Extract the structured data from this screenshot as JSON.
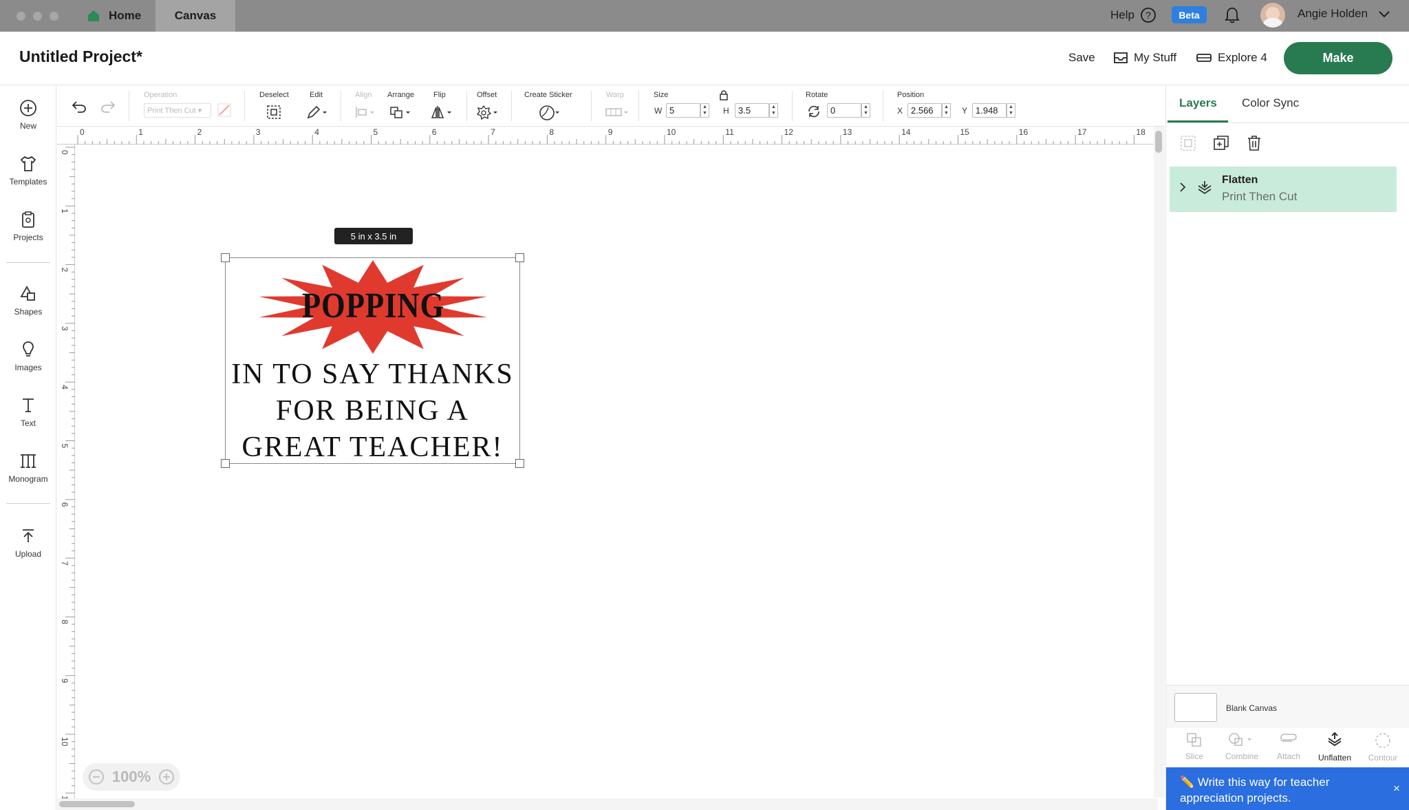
{
  "topbar": {
    "tabs": [
      {
        "label": "Home"
      },
      {
        "label": "Canvas"
      }
    ],
    "help_label": "Help",
    "beta_label": "Beta",
    "user_name": "Angie Holden"
  },
  "header": {
    "project_title": "Untitled Project*",
    "save_label": "Save",
    "mystuff_label": "My Stuff",
    "machine_label": "Explore 4",
    "make_label": "Make"
  },
  "leftbar": {
    "items": [
      {
        "label": "New",
        "icon": "plus-circle-icon"
      },
      {
        "label": "Templates",
        "icon": "tshirt-icon"
      },
      {
        "label": "Projects",
        "icon": "clipboard-icon"
      },
      {
        "label": "Shapes",
        "icon": "shapes-icon"
      },
      {
        "label": "Images",
        "icon": "lightbulb-icon"
      },
      {
        "label": "Text",
        "icon": "text-icon"
      },
      {
        "label": "Monogram",
        "icon": "monogram-icon"
      },
      {
        "label": "Upload",
        "icon": "upload-icon"
      }
    ]
  },
  "toolbar": {
    "operation_label": "Operation",
    "operation_value": "Print Then Cut",
    "deselect_label": "Deselect",
    "edit_label": "Edit",
    "align_label": "Align",
    "arrange_label": "Arrange",
    "flip_label": "Flip",
    "offset_label": "Offset",
    "create_sticker_label": "Create Sticker",
    "warp_label": "Warp",
    "size_label": "Size",
    "w_label": "W",
    "w_value": "5",
    "h_label": "H",
    "h_value": "3.5",
    "rotate_label": "Rotate",
    "rotate_value": "0",
    "position_label": "Position",
    "x_label": "X",
    "x_value": "2.566",
    "y_label": "Y",
    "y_value": "1.948"
  },
  "rulers": {
    "top": [
      "0",
      "1",
      "2",
      "3",
      "4",
      "5",
      "6",
      "7",
      "8",
      "9",
      "10",
      "11",
      "12",
      "13",
      "14",
      "15",
      "16",
      "17",
      "18"
    ],
    "left": [
      "0",
      "1",
      "2",
      "3",
      "4",
      "5",
      "6",
      "7",
      "8",
      "9",
      "10",
      "1"
    ]
  },
  "canvas": {
    "size_tooltip": "5  in x 3.5  in",
    "design_word": "POPPING",
    "design_lines": [
      "IN TO SAY THANKS",
      "FOR BEING A",
      "GREAT TEACHER!"
    ],
    "burst_color": "#e03a2f",
    "zoom_label": "100%"
  },
  "rightpanel": {
    "tabs": [
      {
        "label": "Layers"
      },
      {
        "label": "Color Sync"
      }
    ],
    "layer": {
      "name": "Flatten",
      "sub": "Print Then Cut"
    },
    "blank_canvas_label": "Blank Canvas",
    "bottom_actions": [
      {
        "label": "Slice",
        "enabled": false
      },
      {
        "label": "Combine",
        "enabled": false
      },
      {
        "label": "Attach",
        "enabled": false
      },
      {
        "label": "Unflatten",
        "enabled": true
      },
      {
        "label": "Contour",
        "enabled": false
      }
    ],
    "tip_text": "✏️ Write this way for teacher appreciation projects.",
    "tip_close": "×"
  },
  "colors": {
    "accent": "#287b50",
    "beta": "#2f7fdf",
    "tip": "#2a6ee0",
    "layer_highlight": "#c9ebdb"
  }
}
